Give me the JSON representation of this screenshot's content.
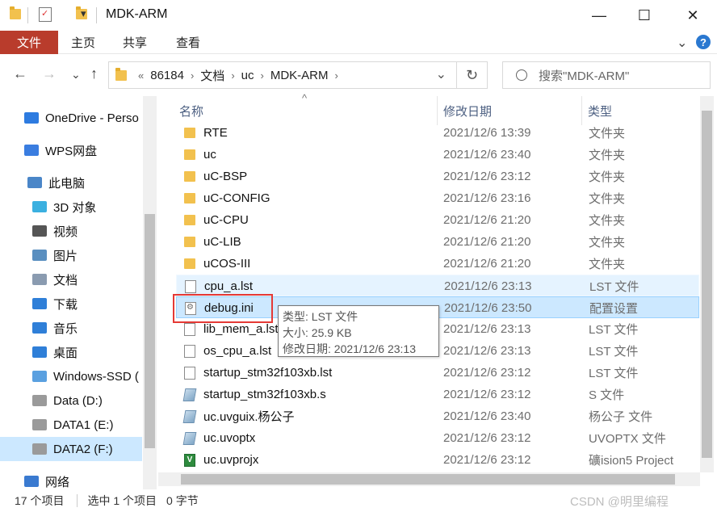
{
  "window": {
    "title": "MDK-ARM",
    "quick_access_down": "▾",
    "minimize": "—",
    "maximize": "☐",
    "close": "✕"
  },
  "ribbon": {
    "tabs": [
      "文件",
      "主页",
      "共享",
      "查看"
    ],
    "expand": "⌄",
    "help": "?"
  },
  "address": {
    "overflow": "«",
    "path": [
      "86184",
      "文档",
      "uc",
      "MDK-ARM"
    ],
    "separator": "›",
    "dropdown": "⌄",
    "refresh": "↻",
    "search_placeholder": "搜索\"MDK-ARM\""
  },
  "nav": {
    "back": "←",
    "forward": "→",
    "recent": "⌄",
    "up": "↑",
    "items": [
      {
        "label": "OneDrive - Perso",
        "icon": "onedrive-icon",
        "color": "#2d7be0"
      },
      {
        "label": "WPS网盘",
        "icon": "wps-cloud-icon",
        "color": "#3a7de0"
      },
      {
        "label": "此电脑",
        "icon": "computer-icon",
        "color": "#4a86c8"
      },
      {
        "label": "3D 对象",
        "icon": "3d-objects-icon",
        "color": "#3bb0e0"
      },
      {
        "label": "视频",
        "icon": "video-icon",
        "color": "#555"
      },
      {
        "label": "图片",
        "icon": "pictures-icon",
        "color": "#5a8fc0"
      },
      {
        "label": "文档",
        "icon": "documents-icon",
        "color": "#8a9bb0"
      },
      {
        "label": "下载",
        "icon": "download-icon",
        "color": "#2f7fd8"
      },
      {
        "label": "音乐",
        "icon": "music-icon",
        "color": "#2f7fd8"
      },
      {
        "label": "桌面",
        "icon": "desktop-icon",
        "color": "#2f7fd8"
      },
      {
        "label": "Windows-SSD (",
        "icon": "windows-drive-icon",
        "color": "#5aa0e0"
      },
      {
        "label": "Data (D:)",
        "icon": "drive-icon",
        "color": "#9a9a9a"
      },
      {
        "label": "DATA1 (E:)",
        "icon": "drive-icon",
        "color": "#9a9a9a"
      },
      {
        "label": "DATA2 (F:)",
        "icon": "drive-icon",
        "color": "#9a9a9a"
      },
      {
        "label": "网络",
        "icon": "network-icon",
        "color": "#3a7ad0"
      }
    ]
  },
  "columns": {
    "name": "名称",
    "date": "修改日期",
    "type": "类型",
    "sort_indicator": "^"
  },
  "files": [
    {
      "name": "RTE",
      "date": "2021/12/6 13:39",
      "type": "文件夹",
      "icon": "folder"
    },
    {
      "name": "uc",
      "date": "2021/12/6 23:40",
      "type": "文件夹",
      "icon": "folder"
    },
    {
      "name": "uC-BSP",
      "date": "2021/12/6 23:12",
      "type": "文件夹",
      "icon": "folder"
    },
    {
      "name": "uC-CONFIG",
      "date": "2021/12/6 23:16",
      "type": "文件夹",
      "icon": "folder"
    },
    {
      "name": "uC-CPU",
      "date": "2021/12/6 21:20",
      "type": "文件夹",
      "icon": "folder"
    },
    {
      "name": "uC-LIB",
      "date": "2021/12/6 21:20",
      "type": "文件夹",
      "icon": "folder"
    },
    {
      "name": "uCOS-III",
      "date": "2021/12/6 21:20",
      "type": "文件夹",
      "icon": "folder"
    },
    {
      "name": "cpu_a.lst",
      "date": "2021/12/6 23:13",
      "type": "LST 文件",
      "icon": "file"
    },
    {
      "name": "debug.ini",
      "date": "2021/12/6 23:50",
      "type": "配置设置",
      "icon": "cfg"
    },
    {
      "name": "lib_mem_a.lst",
      "date": "2021/12/6 23:13",
      "type": "LST 文件",
      "icon": "file"
    },
    {
      "name": "os_cpu_a.lst",
      "date": "2021/12/6 23:13",
      "type": "LST 文件",
      "icon": "file"
    },
    {
      "name": "startup_stm32f103xb.lst",
      "date": "2021/12/6 23:12",
      "type": "LST 文件",
      "icon": "file"
    },
    {
      "name": "startup_stm32f103xb.s",
      "date": "2021/12/6 23:12",
      "type": "S 文件",
      "icon": "s"
    },
    {
      "name": "uc.uvguix.杨公子",
      "date": "2021/12/6 23:40",
      "type": "杨公子 文件",
      "icon": "s"
    },
    {
      "name": "uc.uvoptx",
      "date": "2021/12/6 23:12",
      "type": "UVOPTX 文件",
      "icon": "s"
    },
    {
      "name": "uc.uvprojx",
      "date": "2021/12/6 23:12",
      "type": "礦ision5 Project",
      "icon": "proj"
    }
  ],
  "tooltip": {
    "line1": "类型: LST 文件",
    "line2": "大小: 25.9 KB",
    "line3": "修改日期: 2021/12/6 23:13"
  },
  "status": {
    "count": "17 个项目",
    "selected": "选中 1 个项目",
    "size": "0 字节"
  },
  "watermark": "CSDN @明里编程"
}
